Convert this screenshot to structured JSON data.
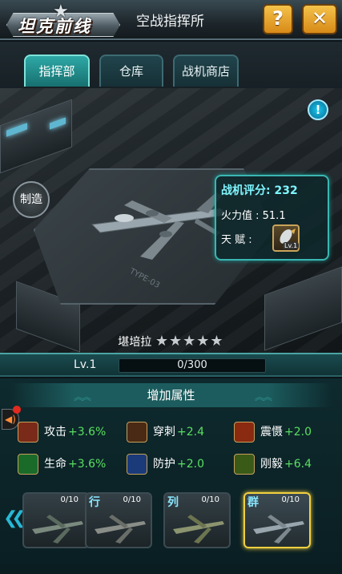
{
  "header": {
    "logo_text": "坦克前线",
    "title": "空战指挥所",
    "help_label": "?",
    "close_label": "✕"
  },
  "tabs": [
    {
      "label": "指挥部",
      "active": true
    },
    {
      "label": "仓库",
      "active": false
    },
    {
      "label": "战机商店",
      "active": false
    }
  ],
  "scene": {
    "craft_button": "制造",
    "info_button": "!",
    "ground_mark": "TYPE-03"
  },
  "plane_info": {
    "score_label": "战机评分: 232",
    "firepower_label": "火力值 : 51.1",
    "talent_label": "天   赋 :",
    "talent_level": "Lv.1"
  },
  "plane": {
    "name": "堪培拉",
    "stars": "★★★★★"
  },
  "level": {
    "label": "Lv.1",
    "xp_text": "0/300",
    "xp_fraction": 0
  },
  "attributes": {
    "title": "增加属性",
    "stats": [
      {
        "name": "攻击",
        "value": "+3.6%",
        "icon": "attack-icon",
        "color": "#7a2a18"
      },
      {
        "name": "穿刺",
        "value": "+2.4",
        "icon": "pierce-icon",
        "color": "#4a2a14"
      },
      {
        "name": "震慑",
        "value": "+2.0",
        "icon": "deter-icon",
        "color": "#8a2a10"
      },
      {
        "name": "生命",
        "value": "+3.6%",
        "icon": "life-icon",
        "color": "#1a6a2a"
      },
      {
        "name": "防护",
        "value": "+2.0",
        "icon": "shield-icon",
        "color": "#1a3a7a"
      },
      {
        "name": "刚毅",
        "value": "+6.4",
        "icon": "fortitude-icon",
        "color": "#3a5a18"
      }
    ]
  },
  "carousel": {
    "cards": [
      {
        "char": "",
        "count": "0/10",
        "selected": false
      },
      {
        "char": "行",
        "count": "0/10",
        "selected": false
      },
      {
        "char": "列",
        "count": "0/10",
        "selected": false
      },
      {
        "char": "群",
        "count": "0/10",
        "selected": true
      }
    ]
  }
}
